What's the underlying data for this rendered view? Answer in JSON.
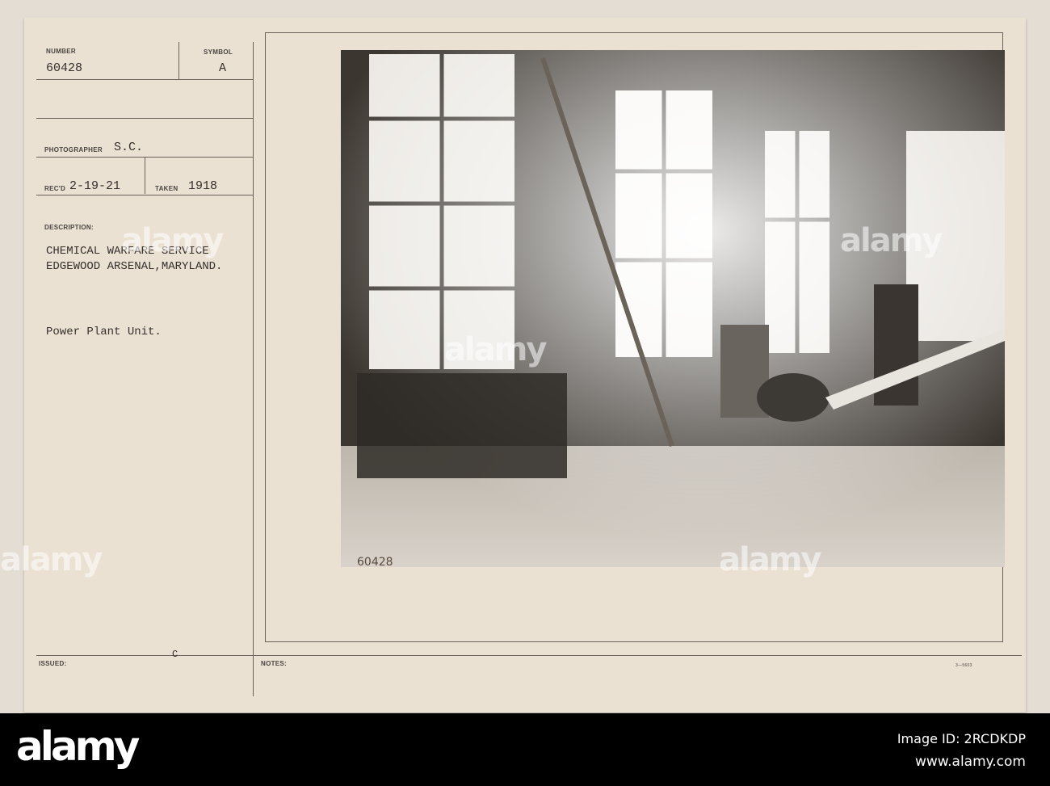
{
  "card": {
    "number_label": "NUMBER",
    "number": "60428",
    "symbol_label": "SYMBOL",
    "symbol": "A",
    "photographer_label": "PHOTOGRAPHER",
    "photographer": "S.C.",
    "recd_label": "REC'D",
    "recd": "2-19-21",
    "taken_label": "TAKEN",
    "taken": "1918",
    "description_label": "DESCRIPTION:",
    "description_line1": "CHEMICAL WARFARE SERVICE",
    "description_line2": "EDGEWOOD ARSENAL,MARYLAND.",
    "caption": "Power Plant Unit.",
    "issued_label": "ISSUED:",
    "issued_mark": "C",
    "notes_label": "NOTES:",
    "form_code": "3—5603",
    "photo_inscription": "60428"
  },
  "watermark": {
    "text": "alamy"
  },
  "footer": {
    "brand": "alamy",
    "image_id": "Image ID: 2RCDKDP",
    "url": "www.alamy.com"
  }
}
